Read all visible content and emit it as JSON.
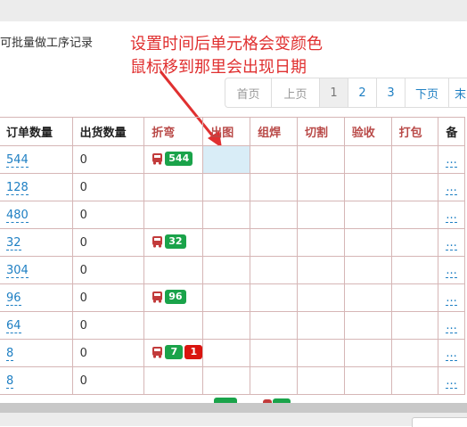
{
  "batch_text": "可批量做工序记录",
  "annotation": {
    "line1": "设置时间后单元格会变颜色",
    "line2": "鼠标移到那里会出现日期",
    "color": "#e03030"
  },
  "pagination": {
    "first": "首页",
    "prev": "上页",
    "pages": [
      "1",
      "2",
      "3"
    ],
    "current": "1",
    "next": "下页",
    "last": "末"
  },
  "table": {
    "headers": [
      "订单数量",
      "出货数量",
      "折弯",
      "出图",
      "组焊",
      "切割",
      "验收",
      "打包",
      "备"
    ],
    "rows": [
      {
        "qty": "544",
        "ship": "0",
        "bend": {
          "green": "544"
        },
        "note": "..."
      },
      {
        "qty": "128",
        "ship": "0",
        "note": "..."
      },
      {
        "qty": "480",
        "ship": "0",
        "note": "..."
      },
      {
        "qty": "32",
        "ship": "0",
        "bend": {
          "green": "32"
        },
        "note": "..."
      },
      {
        "qty": "304",
        "ship": "0",
        "note": "..."
      },
      {
        "qty": "96",
        "ship": "0",
        "bend": {
          "green": "96"
        },
        "note": "..."
      },
      {
        "qty": "64",
        "ship": "0",
        "note": "..."
      },
      {
        "qty": "8",
        "ship": "0",
        "bend": {
          "green": "7",
          "red": "1"
        },
        "note": "..."
      },
      {
        "qty": "8",
        "ship": "0",
        "note": "..."
      }
    ]
  },
  "colors": {
    "link": "#1e7fc3",
    "step_header": "#b94a48",
    "badge_green": "#1aa34a",
    "badge_red": "#d9140f",
    "hover_cell": "#d9edf7"
  },
  "icons": {
    "stage": "bus-icon"
  }
}
